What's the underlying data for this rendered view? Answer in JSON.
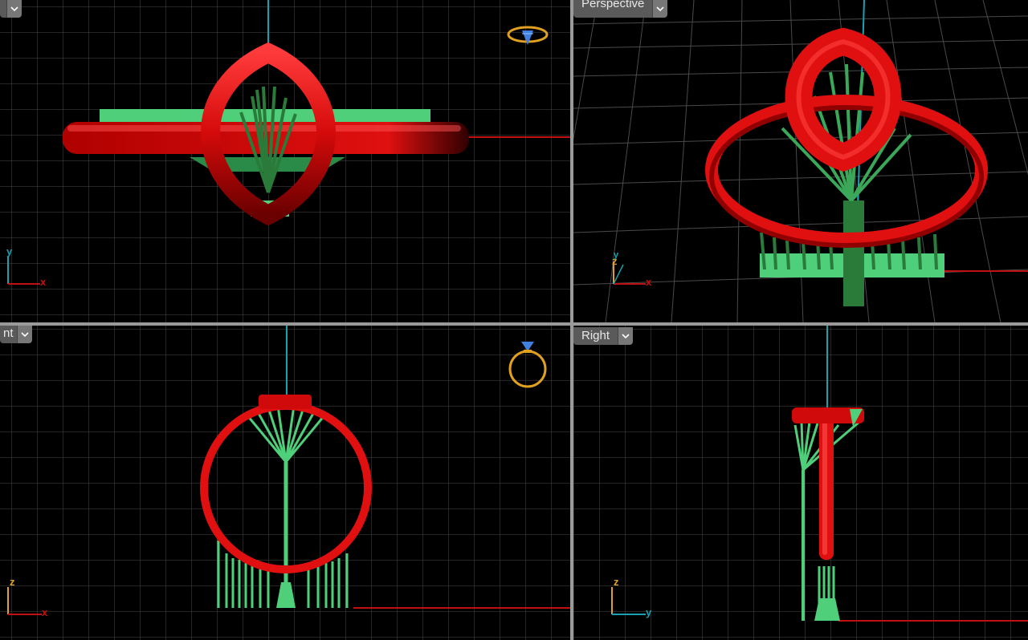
{
  "viewports": {
    "top": {
      "title": "",
      "axis_v": "y",
      "axis_h": "x"
    },
    "perspective": {
      "title": "Perspective",
      "axis_v": "z",
      "axis_h": "x",
      "axis_v2": "y"
    },
    "front": {
      "title": "nt",
      "axis_v": "z",
      "axis_h": "x"
    },
    "right": {
      "title": "Right",
      "axis_v": "z",
      "axis_h": "y"
    }
  },
  "colors": {
    "background": "#000000",
    "grid": "#4a4a4a",
    "grid_major": "#6a6a6a",
    "ring": "#e01010",
    "supports": "#4fcf7a",
    "axis_x": "#c01010",
    "axis_y": "#1aa0b0",
    "separator": "#9a9a9a"
  },
  "icons": {
    "viewport_menu": "chevron-down-icon",
    "view_cube_top": "ring-top-icon",
    "view_cube_front": "ring-front-icon"
  }
}
